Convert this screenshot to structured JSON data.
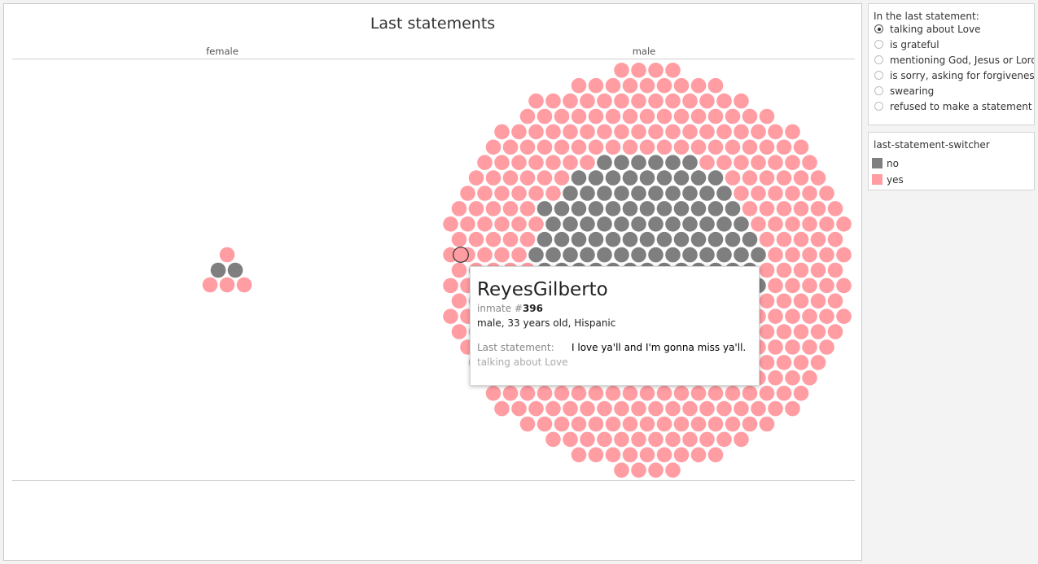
{
  "chart_data": {
    "type": "scatter",
    "title": "Last statements",
    "facets": [
      "female",
      "male"
    ],
    "legend": {
      "title": "last-statement-switcher",
      "placement": "right",
      "entries": [
        {
          "label": "no",
          "color": "#7f7f7f"
        },
        {
          "label": "yes",
          "color": "#ff9da3"
        }
      ]
    },
    "series": [
      {
        "facet": "female",
        "counts": {
          "yes": 4,
          "no": 2
        }
      },
      {
        "facet": "male",
        "counts": {
          "yes": 327,
          "no": 165
        }
      }
    ],
    "highlighted_point": "ReyesGilberto"
  },
  "tooltip": {
    "name": "ReyesGilberto",
    "inmate_prefix": "inmate #",
    "inmate_number": "396",
    "details": "male, 33 years old, Hispanic",
    "statement_label": "Last statement:",
    "statement": "I love ya'll and I'm gonna miss ya'll.",
    "category": "talking about Love"
  },
  "filter": {
    "title": "In the last statement:",
    "options": [
      {
        "label": "talking about Love",
        "selected": true
      },
      {
        "label": "is grateful",
        "selected": false
      },
      {
        "label": "mentioning God, Jesus or Lord",
        "selected": false
      },
      {
        "label": "is sorry, asking for forgiveness",
        "selected": false
      },
      {
        "label": "swearing",
        "selected": false
      },
      {
        "label": "refused to make a statement",
        "selected": false
      }
    ]
  },
  "colors": {
    "yes": "#ff9da3",
    "no": "#7f7f7f"
  }
}
